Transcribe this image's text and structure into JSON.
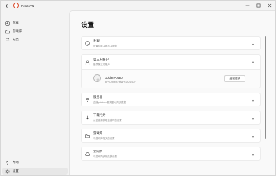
{
  "app": {
    "title": "PotatoVN"
  },
  "sidebar": {
    "items": [
      {
        "label": "游戏",
        "icon": "gamepad-icon"
      },
      {
        "label": "游戏库",
        "icon": "folder-icon"
      },
      {
        "label": "分类",
        "icon": "flag-icon"
      }
    ],
    "bottom_items": [
      {
        "label": "帮助",
        "icon": "help-icon"
      },
      {
        "label": "设置",
        "icon": "gear-icon",
        "active": true
      }
    ]
  },
  "main": {
    "title": "设置",
    "sections": [
      {
        "title": "外观",
        "desc": "设置应用主题与主题色",
        "icon": "palette-icon"
      },
      {
        "title": "第三方账户",
        "desc": "登录第三方账户",
        "icon": "person-icon",
        "expanded": true
      },
      {
        "title": "服务器",
        "desc": "连接potatovn服务器以同步数据",
        "icon": "wifi-icon"
      },
      {
        "title": "下载行为",
        "desc": "从信息源获取信息时的设置",
        "icon": "download-icon"
      },
      {
        "title": "游戏库",
        "desc": "与游戏库相关的设置",
        "icon": "folder-icon"
      },
      {
        "title": "云同步",
        "desc": "与游戏同步相关的设置",
        "icon": "cloud-icon"
      }
    ],
    "account": {
      "name": "GoldenPotato",
      "meta": "用户ID:xxxxx, 登录于:2023/3/27",
      "logout_label": "退出登录"
    }
  },
  "colors": {
    "accent": "#d94b2b",
    "card_bg": "#ffffff",
    "window_bg": "#f3f3f3"
  }
}
